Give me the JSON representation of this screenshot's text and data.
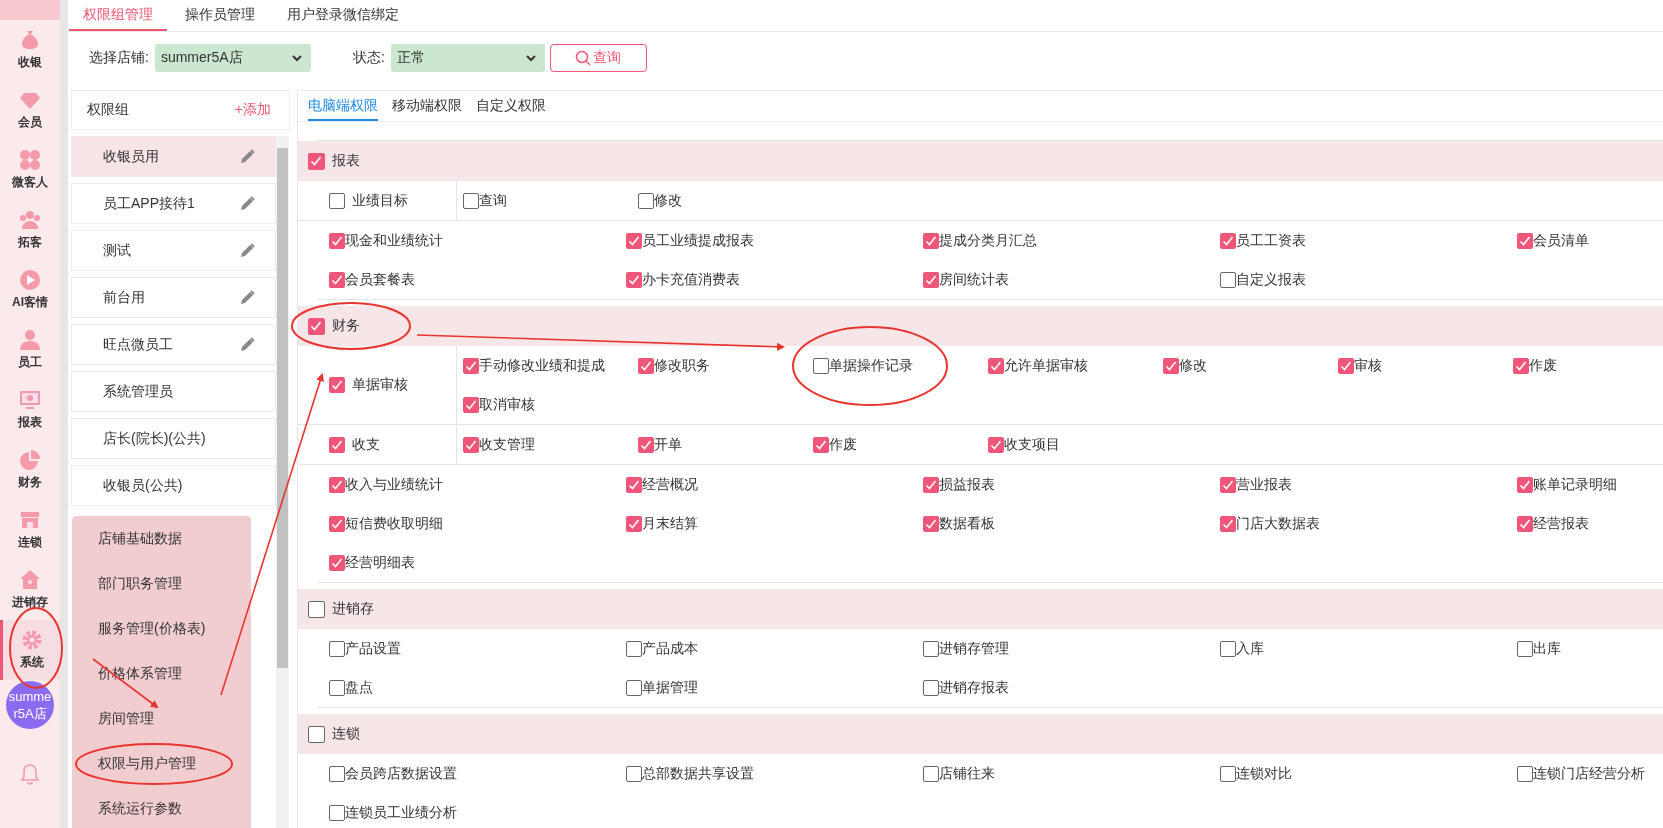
{
  "sidebar": {
    "items": [
      {
        "label": "收银",
        "selected": false
      },
      {
        "label": "会员",
        "selected": false
      },
      {
        "label": "微客人",
        "selected": false
      },
      {
        "label": "拓客",
        "selected": false
      },
      {
        "label": "AI客情",
        "selected": false
      },
      {
        "label": "员工",
        "selected": false
      },
      {
        "label": "报表",
        "selected": false
      },
      {
        "label": "财务",
        "selected": false
      },
      {
        "label": "连锁",
        "selected": false
      },
      {
        "label": "进销存",
        "selected": false
      },
      {
        "label": "系统",
        "selected": true
      }
    ],
    "store_badge": "summer5A店"
  },
  "top_tabs": [
    {
      "label": "权限组管理",
      "selected": true
    },
    {
      "label": "操作员管理",
      "selected": false
    },
    {
      "label": "用户登录微信绑定",
      "selected": false
    }
  ],
  "filters": {
    "store_label": "选择店铺:",
    "store_value": "summer5A店",
    "status_label": "状态:",
    "status_value": "正常",
    "query_button": "查询"
  },
  "group_panel": {
    "title": "权限组",
    "add_link": "+添加",
    "items": [
      {
        "label": "收银员用",
        "selected": true,
        "editable": true
      },
      {
        "label": "员工APP接待1",
        "selected": false,
        "editable": true
      },
      {
        "label": "测试",
        "selected": false,
        "editable": true
      },
      {
        "label": "前台用",
        "selected": false,
        "editable": true
      },
      {
        "label": "旺点微员工",
        "selected": false,
        "editable": true
      },
      {
        "label": "系统管理员",
        "selected": false,
        "editable": false
      },
      {
        "label": "店长(院长)(公共)",
        "selected": false,
        "editable": false
      },
      {
        "label": "收银员(公共)",
        "selected": false,
        "editable": false
      }
    ]
  },
  "system_menu": {
    "items": [
      "店铺基础数据",
      "部门职务管理",
      "服务管理(价格表)",
      "价格体系管理",
      "房间管理",
      "权限与用户管理",
      "系统运行参数"
    ]
  },
  "permission_tabs": [
    {
      "label": "电脑端权限",
      "selected": true
    },
    {
      "label": "移动端权限",
      "selected": false
    },
    {
      "label": "自定义权限",
      "selected": false
    }
  ],
  "sections": [
    {
      "label": "报表",
      "checked": true,
      "groups": [
        {
          "label": "业绩目标",
          "checked": false,
          "items": [
            {
              "label": "查询",
              "checked": false
            },
            {
              "label": "修改",
              "checked": false
            }
          ]
        }
      ],
      "items": [
        {
          "label": "现金和业绩统计",
          "checked": true
        },
        {
          "label": "员工业绩提成报表",
          "checked": true
        },
        {
          "label": "提成分类月汇总",
          "checked": true
        },
        {
          "label": "员工工资表",
          "checked": true
        },
        {
          "label": "会员清单",
          "checked": true
        },
        {
          "label": "会员套餐表",
          "checked": true
        },
        {
          "label": "办卡充值消费表",
          "checked": true
        },
        {
          "label": "房间统计表",
          "checked": true
        },
        {
          "label": "自定义报表",
          "checked": false
        }
      ]
    },
    {
      "label": "财务",
      "checked": true,
      "groups": [
        {
          "label": "单据审核",
          "checked": true,
          "items": [
            {
              "label": "手动修改业绩和提成",
              "checked": true
            },
            {
              "label": "修改职务",
              "checked": true
            },
            {
              "label": "单据操作记录",
              "checked": false
            },
            {
              "label": "允许单据审核",
              "checked": true
            },
            {
              "label": "修改",
              "checked": true
            },
            {
              "label": "审核",
              "checked": true
            },
            {
              "label": "作废",
              "checked": true
            },
            {
              "label": "取消审核",
              "checked": true
            }
          ]
        },
        {
          "label": "收支",
          "checked": true,
          "items": [
            {
              "label": "收支管理",
              "checked": true
            },
            {
              "label": "开单",
              "checked": true
            },
            {
              "label": "作废",
              "checked": true
            },
            {
              "label": "收支项目",
              "checked": true
            }
          ]
        }
      ],
      "items": [
        {
          "label": "收入与业绩统计",
          "checked": true
        },
        {
          "label": "经营概况",
          "checked": true
        },
        {
          "label": "损益报表",
          "checked": true
        },
        {
          "label": "营业报表",
          "checked": true
        },
        {
          "label": "账单记录明细",
          "checked": true
        },
        {
          "label": "短信费收取明细",
          "checked": true
        },
        {
          "label": "月末结算",
          "checked": true
        },
        {
          "label": "数据看板",
          "checked": true
        },
        {
          "label": "门店大数据表",
          "checked": true
        },
        {
          "label": "经营报表",
          "checked": true
        },
        {
          "label": "经营明细表",
          "checked": true
        }
      ]
    },
    {
      "label": "进销存",
      "checked": false,
      "items": [
        {
          "label": "产品设置",
          "checked": false
        },
        {
          "label": "产品成本",
          "checked": false
        },
        {
          "label": "进销存管理",
          "checked": false
        },
        {
          "label": "入库",
          "checked": false
        },
        {
          "label": "出库",
          "checked": false
        },
        {
          "label": "盘点",
          "checked": false
        },
        {
          "label": "单据管理",
          "checked": false
        },
        {
          "label": "进销存报表",
          "checked": false
        }
      ]
    },
    {
      "label": "连锁",
      "checked": false,
      "items": [
        {
          "label": "会员跨店数据设置",
          "checked": false
        },
        {
          "label": "总部数据共享设置",
          "checked": false
        },
        {
          "label": "店铺往来",
          "checked": false
        },
        {
          "label": "连锁对比",
          "checked": false
        },
        {
          "label": "连锁门店经营分析",
          "checked": false
        },
        {
          "label": "连锁员工业绩分析",
          "checked": false
        }
      ]
    }
  ]
}
